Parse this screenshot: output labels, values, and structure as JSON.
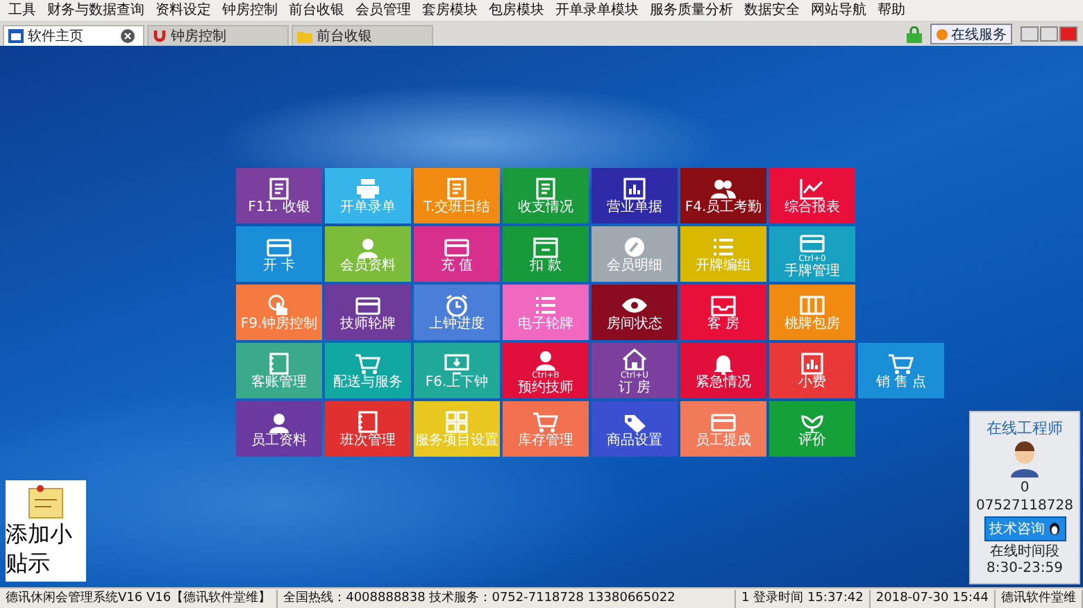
{
  "menu": [
    "工具",
    "财务与数据查询",
    "资料设定",
    "钟房控制",
    "前台收银",
    "会员管理",
    "套房模块",
    "包房模块",
    "开单录单模块",
    "服务质量分析",
    "数据安全",
    "网站导航",
    "帮助"
  ],
  "tabs": [
    {
      "label": "软件主页",
      "selected": true
    },
    {
      "label": "钟房控制",
      "selected": false
    },
    {
      "label": "前台收银",
      "selected": false
    }
  ],
  "service_button": "在线服务",
  "tile_rows": [
    {
      "tiles": [
        {
          "label": "F11. 收银",
          "color": "#7b3f9e"
        },
        {
          "label": "开单录单",
          "color": "#35b5ea"
        },
        {
          "label": "T.交班日结",
          "color": "#f08a10"
        },
        {
          "label": "收支情况",
          "color": "#1a9a3a"
        },
        {
          "label": "营业单据",
          "color": "#2e2aa8"
        },
        {
          "label": "F4.员工考勤",
          "color": "#8b0d14"
        },
        {
          "label": "综合报表",
          "color": "#e8103a"
        }
      ]
    },
    {
      "tiles": [
        {
          "label": "开 卡",
          "color": "#1a8fd8"
        },
        {
          "label": "会员资料",
          "color": "#7bbd3a"
        },
        {
          "label": "充 值",
          "color": "#d7308c"
        },
        {
          "label": "扣 款",
          "color": "#169a3a"
        },
        {
          "label": "会员明细",
          "color": "#a0a8b0"
        },
        {
          "label": "开牌编组",
          "color": "#d8b800"
        },
        {
          "label": "手牌管理",
          "color": "#18a0c0",
          "hint": "Ctrl+0"
        }
      ]
    },
    {
      "tiles": [
        {
          "label": "F9.钟房控制",
          "color": "#f47a40"
        },
        {
          "label": "技师轮牌",
          "color": "#6e3b9a"
        },
        {
          "label": "上钟进度",
          "color": "#4a7ed8"
        },
        {
          "label": "电子轮牌",
          "color": "#f068c0"
        },
        {
          "label": "房间状态",
          "color": "#8a0a20"
        },
        {
          "label": "客 房",
          "color": "#e8103a"
        },
        {
          "label": "桃牌包房",
          "color": "#f08a10"
        }
      ]
    },
    {
      "tiles": [
        {
          "label": "客账管理",
          "color": "#3aaa8a"
        },
        {
          "label": "配送与服务",
          "color": "#10a8a0"
        },
        {
          "label": "F6.上下钟",
          "color": "#20a898"
        },
        {
          "label": "预约技师",
          "color": "#e0103a",
          "hint": "Ctrl+B"
        },
        {
          "label": "订 房",
          "color": "#7b3f9e",
          "hint": "Ctrl+U"
        },
        {
          "label": "紧急情况",
          "color": "#e0103a"
        },
        {
          "label": "小费",
          "color": "#e83838"
        },
        {
          "label": "销 售 点",
          "color": "#1a8fd8"
        }
      ]
    },
    {
      "tiles": [
        {
          "label": "员工资料",
          "color": "#6a3aa0"
        },
        {
          "label": "班次管理",
          "color": "#e03030"
        },
        {
          "label": "服务项目设置",
          "color": "#e8c820"
        },
        {
          "label": "库存管理",
          "color": "#f07050"
        },
        {
          "label": "商品设置",
          "color": "#3a50d0"
        },
        {
          "label": "员工提成",
          "color": "#f07a5a"
        },
        {
          "label": "评价",
          "color": "#16a03a"
        }
      ]
    }
  ],
  "note": {
    "label": "添加小贴示"
  },
  "engineer_panel": {
    "title": "在线工程师",
    "count": "0",
    "phone": "07527118728",
    "button": "技术咨询",
    "hours": "在线时间段 8:30-23:59"
  },
  "status_bar": [
    "德讯休闲会管理系统V16 V16【德讯软件堂维】",
    "全国热线：4008888838 技术服务：0752-7118728 13380665022",
    "1 登录时间 15:37:42",
    "2018-07-30 15:44",
    "德讯软件堂维"
  ]
}
